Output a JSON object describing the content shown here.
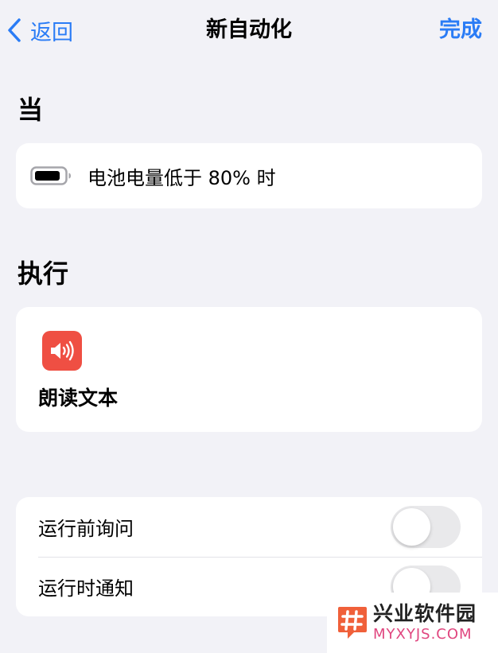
{
  "nav": {
    "back_label": "返回",
    "title": "新自动化",
    "done_label": "完成"
  },
  "trigger": {
    "section_title": "当",
    "label": "电池电量低于 80% 时",
    "icon": "battery-icon"
  },
  "action": {
    "section_title": "执行",
    "label": "朗读文本",
    "icon": "speaker-icon"
  },
  "settings": [
    {
      "label": "运行前询问",
      "enabled": false
    },
    {
      "label": "运行时通知",
      "enabled": false
    }
  ],
  "watermark": {
    "title": "兴业软件园",
    "url": "MYXYJS.COM"
  },
  "colors": {
    "accent": "#2a7cf6",
    "background": "#f2f2f7",
    "card": "#ffffff",
    "action_icon": "#ef4f43",
    "toggle_off": "#e9e9eb"
  }
}
